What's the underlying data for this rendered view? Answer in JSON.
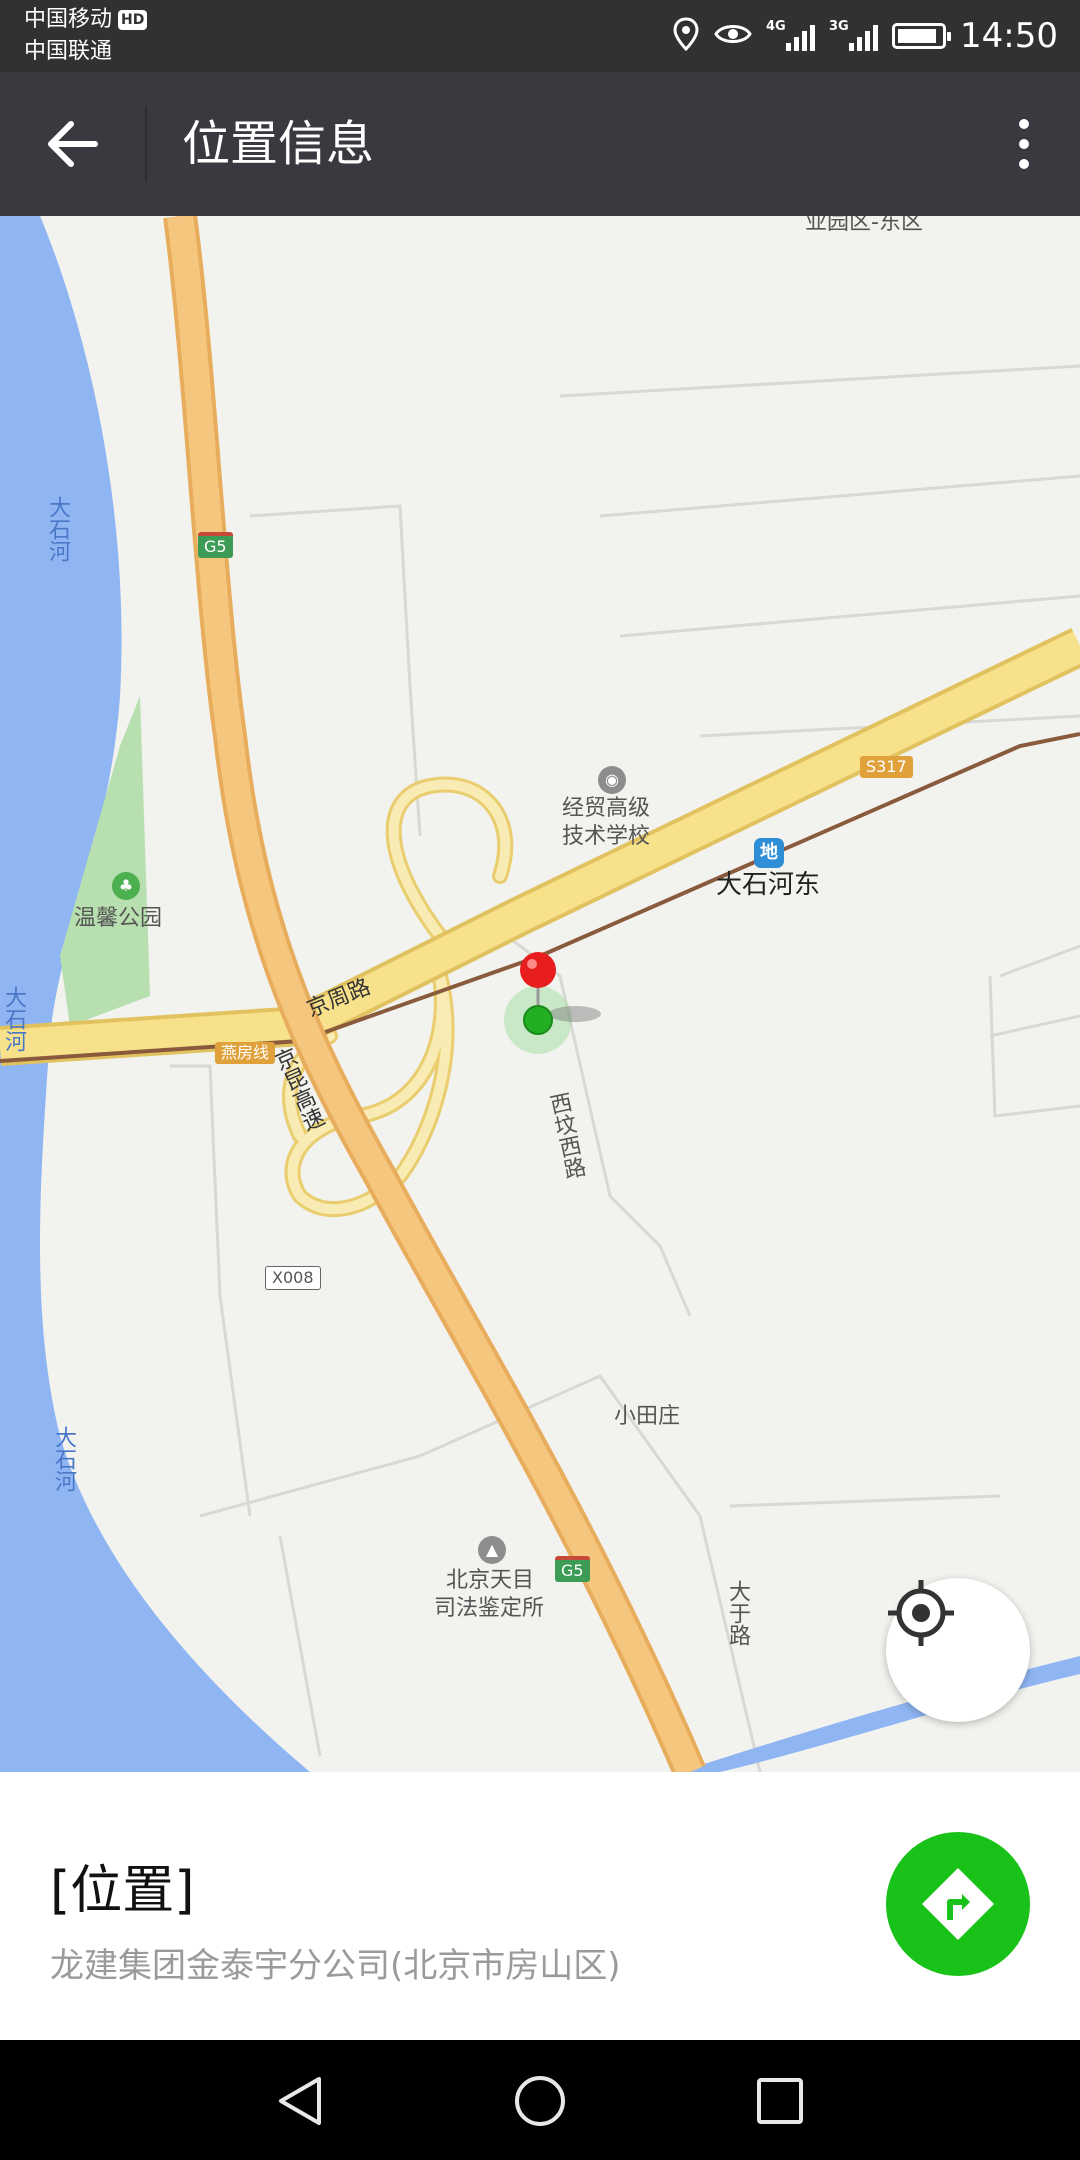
{
  "status_bar": {
    "carrier_1": "中国移动",
    "hd_badge": "HD",
    "carrier_2": "中国联通",
    "signal_1_type": "4G",
    "signal_2_type": "3G",
    "time": "14:50",
    "icons": [
      "location-icon",
      "eye-icon",
      "signal-icon",
      "battery-icon"
    ]
  },
  "header": {
    "title": "位置信息",
    "back_icon": "arrow-left-icon",
    "more_icon": "more-vertical-icon"
  },
  "map": {
    "labels": {
      "top_area": "业园区-东区",
      "river_1": "大石河",
      "river_2": "大石河",
      "river_3": "大石河",
      "school": "经贸高级\n技术学校",
      "school_line1": "经贸高级",
      "school_line2": "技术学校",
      "park": "温馨公园",
      "subway_station": "大石河东",
      "road_jingzhou": "京周路",
      "road_jingkun": "京昆高速",
      "road_xifang": "西坟西路",
      "village": "小田庄",
      "court_line1": "北京天目",
      "court_line2": "司法鉴定所",
      "road_dayu": "大于路"
    },
    "road_tags": {
      "g5_top": "G5",
      "g5_bottom": "G5",
      "s317": "S317",
      "yanfang": "燕房线",
      "x008": "X008"
    },
    "subway_symbol": "地",
    "colors": {
      "water": "#8fb5f3",
      "highway": "#f5c77e",
      "highway_edge": "#e8ad5c",
      "road_yellow": "#f7e18a",
      "park": "#b7dfb0",
      "rail": "#8a5a3c",
      "marker_red": "#e81d1d",
      "marker_green": "#22b022"
    }
  },
  "info": {
    "title": "[位置]",
    "address": "龙建集团金泰宇分公司(北京市房山区)",
    "navigate_icon": "directions-icon",
    "navigate_color": "#19c219"
  },
  "system_nav": {
    "icons": [
      "back-triangle-icon",
      "home-circle-icon",
      "recents-square-icon"
    ]
  }
}
